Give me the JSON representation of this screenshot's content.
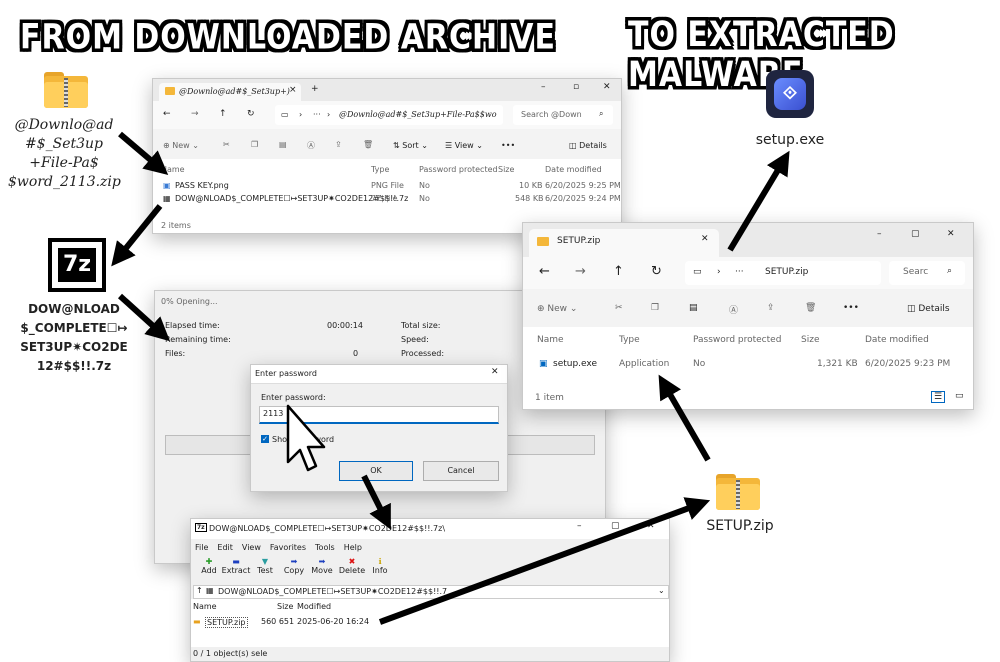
{
  "headings": {
    "left": "FROM DOWNLOADED ARCHIVE",
    "right": "TO EXTRACTED MALWARE"
  },
  "downloaded_zip": {
    "filename": "@Downlo@ad\n#$_Set3up\n+File-Pa$\n$word_2113.zip"
  },
  "archive_7z": {
    "filename": "DOW@NLOAD\n$_COMPLETE☐↦\nSET3UP✷CO2DE\n12#$$!!.7z",
    "icon_label": "7z"
  },
  "setup_exe": {
    "label": "setup.exe"
  },
  "setup_zip_icon": {
    "label": "SETUP.zip"
  },
  "explorer1": {
    "tab": "@Downlo@ad#$_Set3up+)",
    "path": "@Downlo@ad#$_Set3up+File-Pa$$wo",
    "search": "Search @Down",
    "toolbar": {
      "new": "New",
      "sort": "Sort",
      "view": "View",
      "more": "•••",
      "details": "Details"
    },
    "columns": {
      "name": "Name",
      "type": "Type",
      "password": "Password protected",
      "size": "Size",
      "modified": "Date modified"
    },
    "rows": [
      {
        "name": "PASS KEY.png",
        "type": "PNG File",
        "password": "No",
        "size": "10 KB",
        "modified": "6/20/2025 9:25 PM"
      },
      {
        "name": "DOW@NLOAD$_COMPLETE☐↦SET3UP✷CO2DE12#$$!!.7z",
        "type": "7Z File",
        "password": "No",
        "size": "548 KB",
        "modified": "6/20/2025 9:24 PM"
      }
    ],
    "status": "2 items"
  },
  "progress_dialog": {
    "title": "0% Opening...",
    "elapsed_label": "Elapsed time:",
    "elapsed_value": "00:00:14",
    "remaining_label": "Remaining time:",
    "files_label": "Files:",
    "files_value": "0",
    "total_label": "Total size:",
    "speed_label": "Speed:",
    "processed_label": "Processed:"
  },
  "password_dialog": {
    "title": "Enter password",
    "prompt": "Enter password:",
    "value": "2113",
    "show_label": "Show password",
    "ok": "OK",
    "cancel": "Cancel"
  },
  "explorer2": {
    "tab": "SETUP.zip",
    "path": "SETUP.zip",
    "search": "Searc",
    "toolbar": {
      "new": "New",
      "more": "•••",
      "details": "Details"
    },
    "columns": {
      "name": "Name",
      "type": "Type",
      "password": "Password protected",
      "size": "Size",
      "modified": "Date modified"
    },
    "rows": [
      {
        "name": "setup.exe",
        "type": "Application",
        "password": "No",
        "size": "1,321 KB",
        "modified": "6/20/2025 9:23 PM"
      }
    ],
    "status": "1 item"
  },
  "sevenzip": {
    "title": "DOW@NLOAD$_COMPLETE☐↦SET3UP✷CO2DE12#$$!!.7z\\",
    "menu": [
      "File",
      "Edit",
      "View",
      "Favorites",
      "Tools",
      "Help"
    ],
    "tools": [
      "Add",
      "Extract",
      "Test",
      "Copy",
      "Move",
      "Delete",
      "Info"
    ],
    "address": "DOW@NLOAD$_COMPLETE☐↦SET3UP✷CO2DE12#$$!!.7",
    "columns": {
      "name": "Name",
      "size": "Size",
      "modified": "Modified"
    },
    "rows": [
      {
        "name": "SETUP.zip",
        "size": "560 651",
        "modified": "2025-06-20 16:24"
      }
    ],
    "status": "0 / 1 object(s) sele"
  },
  "colors": {
    "accent": "#0067c0",
    "folder": "#f4b73a",
    "arrow": "#000000"
  }
}
